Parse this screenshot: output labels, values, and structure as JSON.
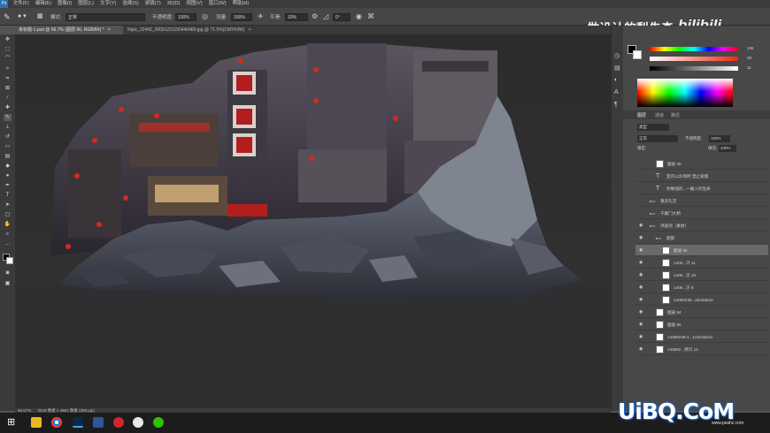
{
  "menubar": {
    "items": [
      "文件(F)",
      "编辑(E)",
      "图像(I)",
      "图层(L)",
      "文字(Y)",
      "选择(S)",
      "滤镜(T)",
      "3D(D)",
      "视图(V)",
      "窗口(W)",
      "帮助(H)"
    ]
  },
  "options": {
    "mode_label": "模式:",
    "mode_value": "正常",
    "opacity_label": "不透明度:",
    "opacity_value": "100%",
    "flow_label": "流量:",
    "flow_value": "100%",
    "smooth_label": "平滑:",
    "smooth_value": "10%",
    "angle_value": "0°"
  },
  "tabs": [
    {
      "label": "未标题-1.psd @ 66.7% (图层 96, RGB/8#) *"
    },
    {
      "label": "Nipic_22442_20091221150440489.jpg @ 71.5%(CMYK/8#)"
    }
  ],
  "status": {
    "zoom": "66.67%",
    "doc": "2543 像素 x 4961 像素 (300 ppi)"
  },
  "watermark": {
    "top_text": "做设计的梨先森",
    "bili": "bilibili",
    "bottom_logo": "UiBQ.CoM",
    "bottom_sub": "www.psahz.com"
  },
  "panels": {
    "color_values": [
      "236",
      "39",
      "11"
    ],
    "tabs": [
      "图层",
      "通道",
      "路径"
    ],
    "kind_label": "类型",
    "blend": "正常",
    "opacity_label": "不透明度:",
    "opacity_value": "100%",
    "lock_label": "锁定:",
    "fill_label": "填充:",
    "fill_value": "100%",
    "layers": [
      {
        "name": "图层 40",
        "indent": 1,
        "thumb": true,
        "eye": false
      },
      {
        "name": "室内公众场所  禁止吸烟",
        "indent": 1,
        "thumb": false,
        "eye": false,
        "type": "T"
      },
      {
        "name": "你勉强的...一推入的生命",
        "indent": 1,
        "thumb": false,
        "eye": false,
        "type": "T"
      },
      {
        "name": "重庆礼堂",
        "indent": 0,
        "thumb": false,
        "eye": false,
        "folder": true
      },
      {
        "name": "千厮门大桥",
        "indent": 0,
        "thumb": false,
        "eye": false,
        "folder": true
      },
      {
        "name": "洪崖洞（素材）",
        "indent": 0,
        "thumb": false,
        "eye": true,
        "folder": true
      },
      {
        "name": "底部",
        "indent": 1,
        "thumb": false,
        "eye": true,
        "folder": true
      },
      {
        "name": "图层 96",
        "indent": 2,
        "thumb": true,
        "eye": true,
        "selected": true
      },
      {
        "name": "1406...贝 11",
        "indent": 2,
        "thumb": true,
        "eye": true
      },
      {
        "name": "1406...贝 10",
        "indent": 2,
        "thumb": true,
        "eye": true
      },
      {
        "name": "1406...贝 9",
        "indent": 2,
        "thumb": true,
        "eye": true
      },
      {
        "name": "14068236...a543a510",
        "indent": 2,
        "thumb": true,
        "eye": true
      },
      {
        "name": "图层 64",
        "indent": 1,
        "thumb": true,
        "eye": true
      },
      {
        "name": "图层 95",
        "indent": 1,
        "thumb": true,
        "eye": true
      },
      {
        "name": "14068236-4...1c543a510",
        "indent": 1,
        "thumb": true,
        "eye": true
      },
      {
        "name": "140682...拷贝 13",
        "indent": 1,
        "thumb": true,
        "eye": true
      }
    ]
  },
  "colors": {
    "ps_bg": "#535353",
    "panel": "#484848",
    "selected_layer": "#6a6a6a"
  }
}
